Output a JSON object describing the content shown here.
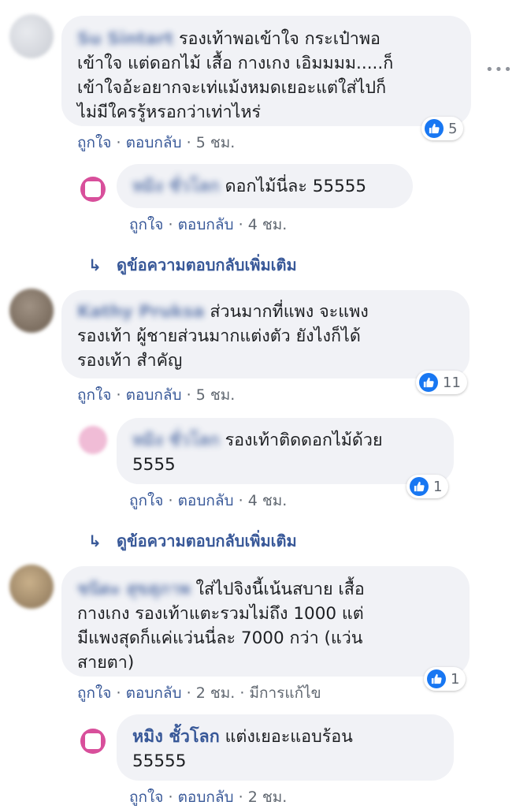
{
  "comments": [
    {
      "author": "Su Sintart",
      "text_lines": [
        "รองเท้าพอเข้าใจ กระเป๋าพอ",
        "เข้าใจ แต่ดอกไม้ เสื้อ กางเกง เอิมมมม.....ก็",
        "เข้าใจอ้ะอยากจะเท่แม้งหมดเยอะแต่ใส่ไปก็",
        "ไม่มีใครรู้หรอกว่าเท่าไหร่"
      ],
      "like_action": "ถูกใจ",
      "reply_action": "ตอบกลับ",
      "time": "5 ชม.",
      "reactions": "5",
      "more_icon": "ellipsis-icon"
    },
    {
      "author": "หมิง ชั่วโลก",
      "text_lines": [
        "ดอกไม้นี่ละ 55555"
      ],
      "like_action": "ถูกใจ",
      "reply_action": "ตอบกลับ",
      "time": "4 ชม."
    },
    {
      "view_more": "ดูข้อความตอบกลับเพิ่มเติม"
    },
    {
      "author": "Kathy Pruksa",
      "text_lines": [
        "ส่วนมากที่แพง จะแพง",
        "รองเท้า ผู้ชายส่วนมากแต่งตัว ยังไงก็ได้",
        "รองเท้า สำคัญ"
      ],
      "like_action": "ถูกใจ",
      "reply_action": "ตอบกลับ",
      "time": "5 ชม.",
      "reactions": "11"
    },
    {
      "author": "หมิง ชั่วโลก",
      "text_lines": [
        "รองเท้าติดดอกไม้ด้วย",
        "5555"
      ],
      "like_action": "ถูกใจ",
      "reply_action": "ตอบกลับ",
      "time": "4 ชม.",
      "reactions": "1"
    },
    {
      "view_more": "ดูข้อความตอบกลับเพิ่มเติม"
    },
    {
      "author": "ชนิดะ สุขสุภาพ",
      "text_lines": [
        "ใส่ไปจิงนี้เน้นสบาย เสื้อ",
        "กางเกง รองเท้าแตะรวมไม่ถึง 1000 แต่",
        "มีแพงสุดก็แค่แว่นนี่ละ 7000 กว่า (แว่น",
        "สายตา)"
      ],
      "like_action": "ถูกใจ",
      "reply_action": "ตอบกลับ",
      "time": "2 ชม.",
      "edited": "มีการแก้ไข",
      "reactions": "1"
    },
    {
      "author": "หมิง ชั้วโลก",
      "text_lines": [
        "แต่งเยอะแอบร้อน",
        "55555"
      ],
      "like_action": "ถูกใจ",
      "reply_action": "ตอบกลับ",
      "time": "2 ชม."
    }
  ],
  "separator": "·",
  "colors": {
    "link": "#385898",
    "bubble": "#f1f2f6",
    "like": "#1877f2",
    "meta": "#606770"
  }
}
